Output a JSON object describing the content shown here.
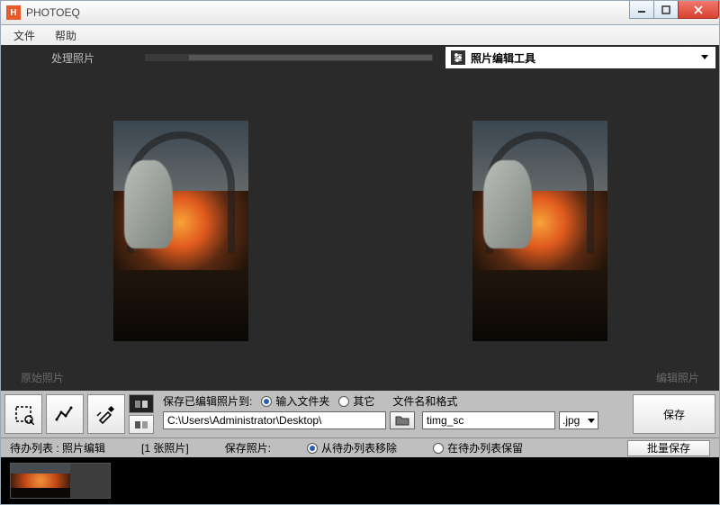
{
  "window": {
    "title": "PHOTOEQ",
    "app_icon_glyph": "H"
  },
  "menubar": {
    "file": "文件",
    "help": "帮助"
  },
  "top_strip": {
    "processing_label": "处理照片",
    "tools_label": "照片编辑工具"
  },
  "preview": {
    "original_caption": "原始照片",
    "edited_caption": "编辑照片"
  },
  "save_panel": {
    "save_to_label": "保存已编辑照片到:",
    "radio_input_folder": "输入文件夹",
    "radio_other": "其它",
    "filename_format_label": "文件名和格式",
    "path_value": "C:\\Users\\Administrator\\Desktop\\",
    "filename_value": "timg_sc",
    "ext_value": ".jpg",
    "save_button": "保存"
  },
  "todo_bar": {
    "todo_label": "待办列表 : 照片编辑",
    "count_label": "[1 张照片]",
    "save_photo_label": "保存照片:",
    "radio_remove": "从待办列表移除",
    "radio_keep": "在待办列表保留",
    "batch_save": "批量保存"
  }
}
